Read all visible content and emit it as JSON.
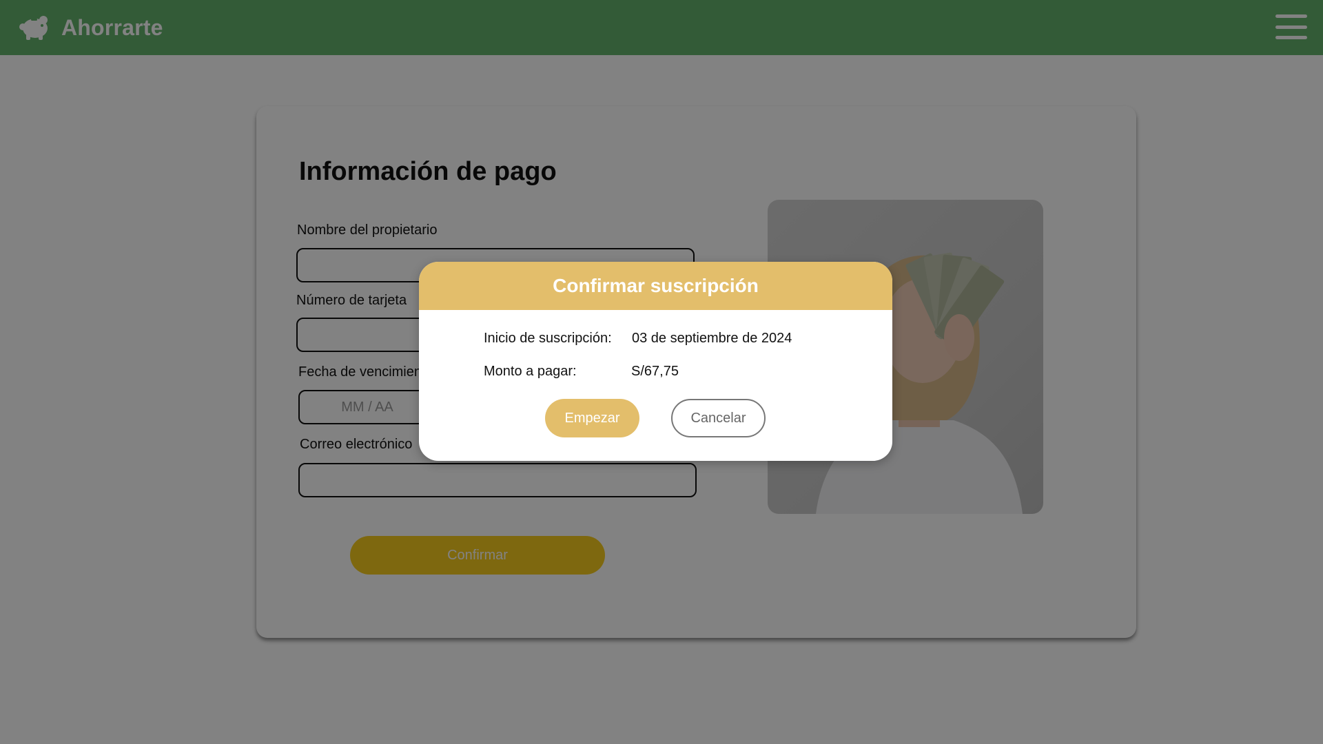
{
  "header": {
    "app_name": "Ahorrarte",
    "logo_icon": "piggy-bank-icon",
    "menu_icon": "hamburger-menu-icon",
    "background_color": "#64b36c"
  },
  "form": {
    "title": "Información de pago",
    "owner_label": "Nombre del propietario",
    "owner_value": "",
    "card_label": "Número de tarjeta",
    "card_value": "",
    "expiry_label": "Fecha de vencimiento",
    "expiry_placeholder": "MM / AA",
    "email_label": "Correo electrónico",
    "email_value": "",
    "confirm_label": "Confirmar",
    "confirm_color": "#f8cd1f"
  },
  "image": {
    "description_icon": "woman-holding-money-photo"
  },
  "modal": {
    "title": "Confirmar suscripción",
    "start_label": "Inicio de suscripción:",
    "start_value": "03 de septiembre de 2024",
    "amount_label": "Monto a pagar:",
    "amount_value": "S/67,75",
    "start_button": "Empezar",
    "cancel_button": "Cancelar",
    "accent_color": "#e3be6b"
  }
}
